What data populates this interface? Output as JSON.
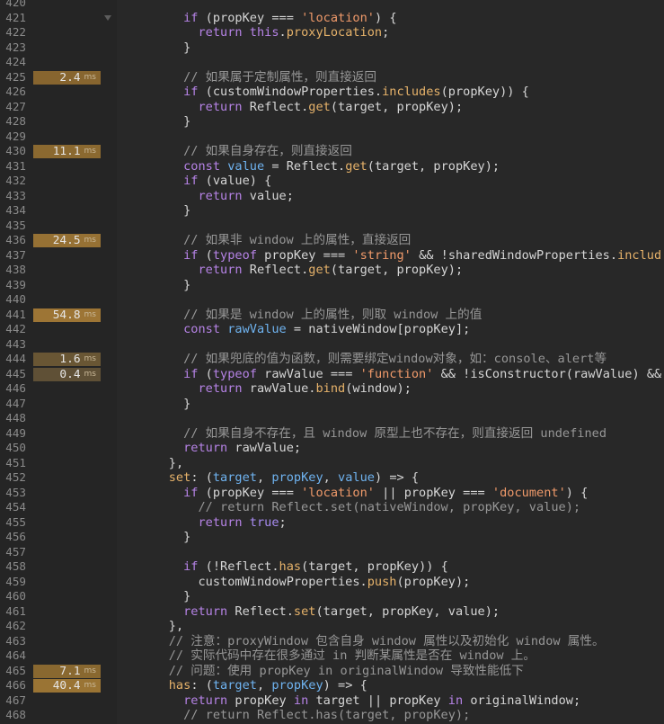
{
  "theme": {
    "gutter_background": "#252525",
    "editor_background": "#282828",
    "line_number_color": "#8a8a8a",
    "syntax_colors": {
      "text": "#d6d6d6",
      "keyword": "#b683e6",
      "string": "#f09a6a",
      "property": "#e6b26a",
      "definition": "#6fb3f0",
      "atom": "#a88cf2",
      "comment": "#979797"
    }
  },
  "editor": {
    "lines": [
      {
        "number": "420",
        "code": ""
      },
      {
        "number": "421",
        "code": "      if (propKey === 'location') {",
        "fold_icon": "fold-triangle-down-icon"
      },
      {
        "number": "422",
        "code": "        return this.proxyLocation;"
      },
      {
        "number": "423",
        "code": "      }"
      },
      {
        "number": "424",
        "code": ""
      },
      {
        "number": "425",
        "code": "      // 如果属于定制属性，则直接返回",
        "timing": {
          "value": "2.4",
          "unit": "ms",
          "color": "#87652f"
        }
      },
      {
        "number": "426",
        "code": "      if (customWindowProperties.includes(propKey)) {"
      },
      {
        "number": "427",
        "code": "        return Reflect.get(target, propKey);"
      },
      {
        "number": "428",
        "code": "      }"
      },
      {
        "number": "429",
        "code": ""
      },
      {
        "number": "430",
        "code": "      // 如果自身存在，则直接返回",
        "timing": {
          "value": "11.1",
          "unit": "ms",
          "color": "#8b6930"
        }
      },
      {
        "number": "431",
        "code": "      const value = Reflect.get(target, propKey);"
      },
      {
        "number": "432",
        "code": "      if (value) {"
      },
      {
        "number": "433",
        "code": "        return value;"
      },
      {
        "number": "434",
        "code": "      }"
      },
      {
        "number": "435",
        "code": ""
      },
      {
        "number": "436",
        "code": "      // 如果非 window 上的属性，直接返回",
        "timing": {
          "value": "24.5",
          "unit": "ms",
          "color": "#967134"
        }
      },
      {
        "number": "437",
        "code": "      if (typeof propKey === 'string' && !sharedWindowProperties.includ"
      },
      {
        "number": "438",
        "code": "        return Reflect.get(target, propKey);"
      },
      {
        "number": "439",
        "code": "      }"
      },
      {
        "number": "440",
        "code": ""
      },
      {
        "number": "441",
        "code": "      // 如果是 window 上的属性，则取 window 上的值",
        "timing": {
          "value": "54.8",
          "unit": "ms",
          "color": "#9d7535"
        }
      },
      {
        "number": "442",
        "code": "      const rawValue = nativeWindow[propKey];"
      },
      {
        "number": "443",
        "code": ""
      },
      {
        "number": "444",
        "code": "      // 如果兜底的值为函数，则需要绑定window对象，如：console、alert等",
        "timing": {
          "value": "1.6",
          "unit": "ms",
          "color": "#695634"
        }
      },
      {
        "number": "445",
        "code": "      if (typeof rawValue === 'function' && !isConstructor(rawValue) &&",
        "timing": {
          "value": "0.4",
          "unit": "ms",
          "color": "#5f5036"
        }
      },
      {
        "number": "446",
        "code": "        return rawValue.bind(window);"
      },
      {
        "number": "447",
        "code": "      }"
      },
      {
        "number": "448",
        "code": ""
      },
      {
        "number": "449",
        "code": "      // 如果自身不存在，且 window 原型上也不存在，则直接返回 undefined"
      },
      {
        "number": "450",
        "code": "      return rawValue;"
      },
      {
        "number": "451",
        "code": "    },"
      },
      {
        "number": "452",
        "code": "    set: (target, propKey, value) => {"
      },
      {
        "number": "453",
        "code": "      if (propKey === 'location' || propKey === 'document') {"
      },
      {
        "number": "454",
        "code": "        // return Reflect.set(nativeWindow, propKey, value);"
      },
      {
        "number": "455",
        "code": "        return true;"
      },
      {
        "number": "456",
        "code": "      }"
      },
      {
        "number": "457",
        "code": ""
      },
      {
        "number": "458",
        "code": "      if (!Reflect.has(target, propKey)) {"
      },
      {
        "number": "459",
        "code": "        customWindowProperties.push(propKey);"
      },
      {
        "number": "460",
        "code": "      }"
      },
      {
        "number": "461",
        "code": "      return Reflect.set(target, propKey, value);"
      },
      {
        "number": "462",
        "code": "    },"
      },
      {
        "number": "463",
        "code": "    // 注意：proxyWindow 包含自身 window 属性以及初始化 window 属性。"
      },
      {
        "number": "464",
        "code": "    // 实际代码中存在很多通过 in 判断某属性是否在 window 上。"
      },
      {
        "number": "465",
        "code": "    // 问题：使用 propKey in originalWindow 导致性能低下",
        "timing": {
          "value": "7.1",
          "unit": "ms",
          "color": "#896830"
        }
      },
      {
        "number": "466",
        "code": "    has: (target, propKey) => {",
        "timing": {
          "value": "40.4",
          "unit": "ms",
          "color": "#9a7434"
        }
      },
      {
        "number": "467",
        "code": "      return propKey in target || propKey in originalWindow;"
      },
      {
        "number": "468",
        "code": "      // return Reflect.has(target, propKey);"
      }
    ]
  }
}
